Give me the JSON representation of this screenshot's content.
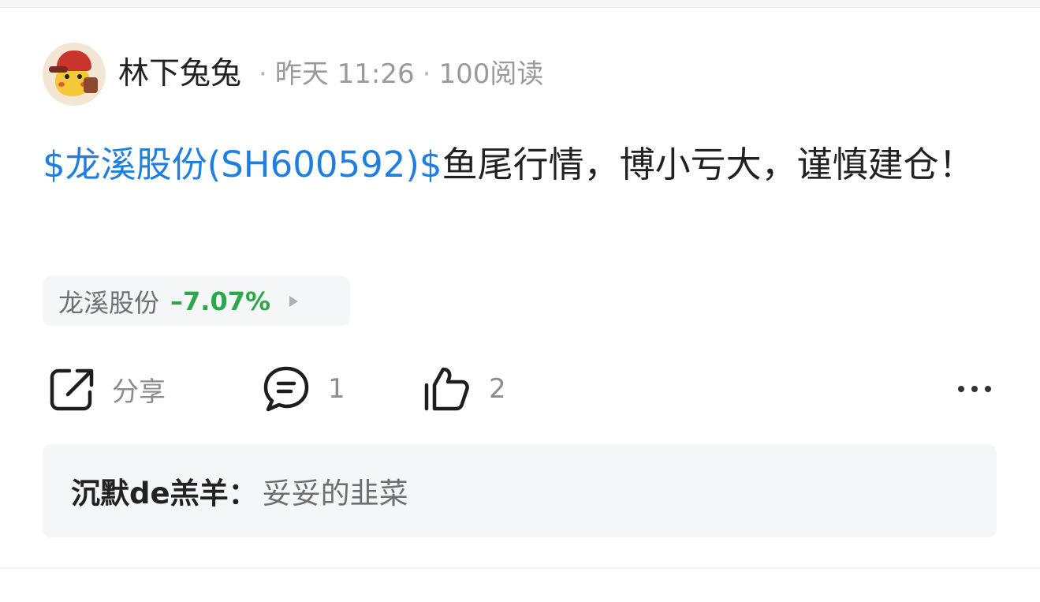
{
  "post": {
    "author": "林下兔兔",
    "time": "昨天 11:26",
    "reads": "100阅读",
    "content_link": "$龙溪股份(SH600592)$",
    "content_text": "鱼尾行情，博小亏大，谨慎建仓！",
    "stock_chip": {
      "name": "龙溪股份",
      "change": "–7.07%",
      "change_color": "#2aa84a"
    },
    "actions": {
      "share_label": "分享",
      "comment_count": "1",
      "like_count": "2"
    },
    "comment_preview": {
      "author": "沉默de羔羊：",
      "text": "妥妥的韭菜"
    }
  },
  "colors": {
    "link": "#1f7fe0",
    "muted": "#9a9a9a",
    "panel": "#f5f6f7"
  }
}
